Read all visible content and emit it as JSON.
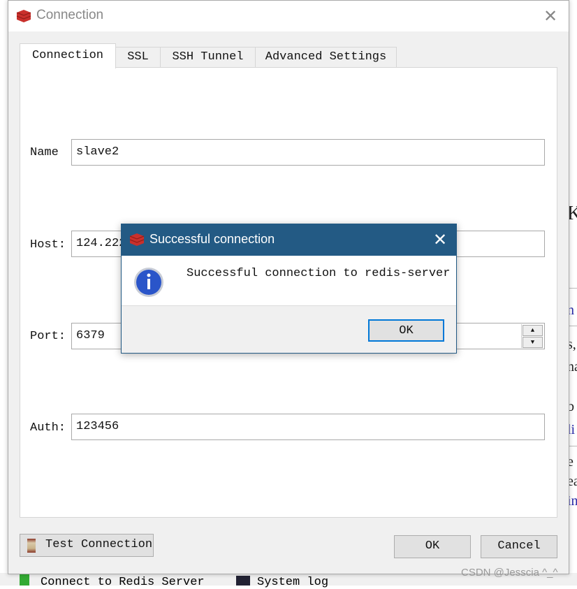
{
  "window": {
    "title": "Connection",
    "close_icon": "close-icon"
  },
  "tabs": [
    {
      "label": "Connection",
      "active": true
    },
    {
      "label": "SSL"
    },
    {
      "label": "SSH Tunnel"
    },
    {
      "label": "Advanced Settings"
    }
  ],
  "form": {
    "name_label": "Name",
    "name_value": "slave2",
    "host_label": "Host:",
    "host_value": "124.222",
    "port_label": "Port:",
    "port_value": "6379",
    "auth_label": "Auth:",
    "auth_value": "123456"
  },
  "buttons": {
    "test_connection": "Test Connection",
    "ok": "OK",
    "cancel": "Cancel"
  },
  "popup": {
    "title": "Successful connection",
    "message": "Successful connection to redis-server",
    "ok": "OK",
    "accent": "#235a84"
  },
  "background": {
    "fragments": [
      "K",
      "n",
      "s,",
      "na",
      "b",
      "li",
      "e",
      "ea",
      "in"
    ],
    "taskbar": [
      "Connect to Redis Server",
      "System log"
    ]
  },
  "watermark": "CSDN @Jesscia ^_^"
}
